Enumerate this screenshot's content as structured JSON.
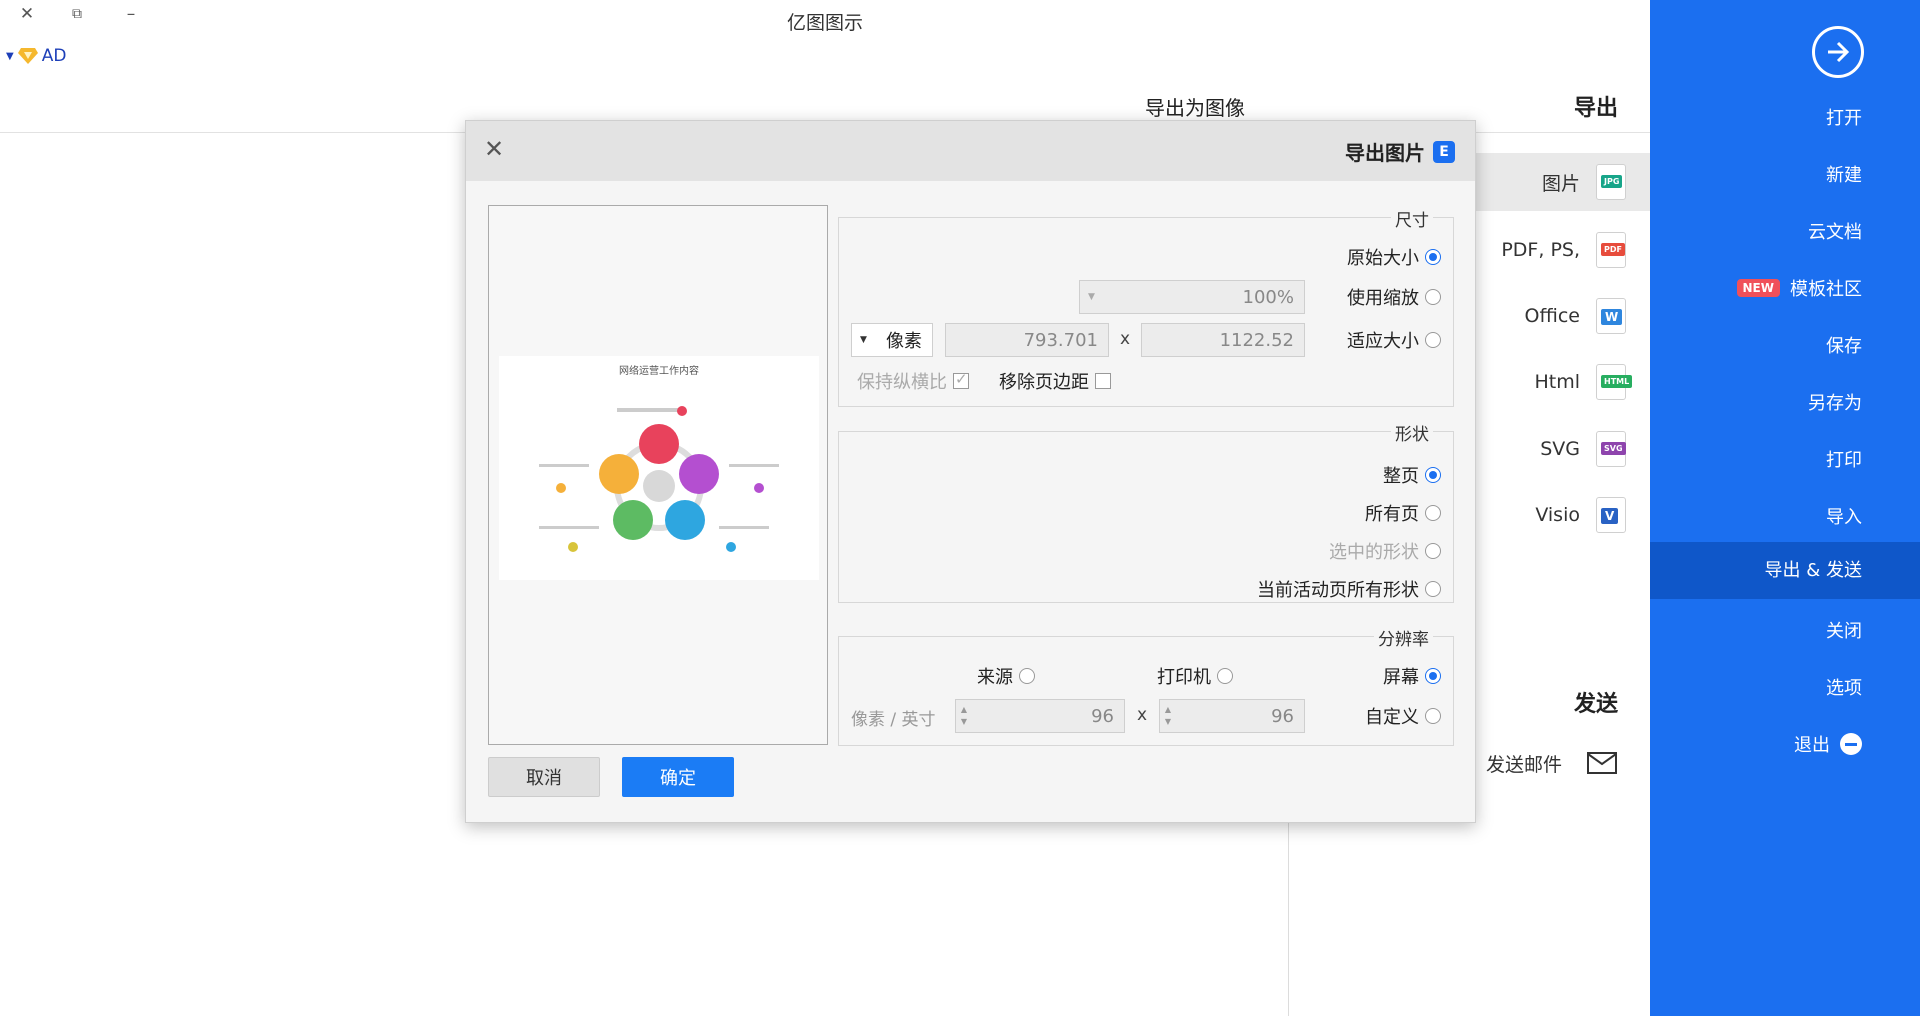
{
  "window": {
    "title": "亿图图示",
    "close": "✕",
    "restore": "⧉",
    "minimize": "–"
  },
  "user": {
    "label": "AD"
  },
  "sidebar": {
    "items": [
      {
        "label": "打开"
      },
      {
        "label": "新建"
      },
      {
        "label": "云文档"
      },
      {
        "label": "模板社区",
        "badge": "NEW"
      },
      {
        "label": "保存"
      },
      {
        "label": "另存为"
      },
      {
        "label": "打印"
      },
      {
        "label": "导入"
      },
      {
        "label": "导出 & 发送"
      },
      {
        "label": "关闭"
      },
      {
        "label": "选项"
      },
      {
        "label": "退出"
      }
    ]
  },
  "export_panel": {
    "heading": "导出",
    "subtitle": "导出为图像",
    "send_heading": "发送",
    "rows": [
      {
        "label": "图片",
        "tag": "JPG",
        "color": "#17a589"
      },
      {
        "label": "PDF, PS,",
        "tag": "PDF",
        "color": "#e74c3c"
      },
      {
        "label": "Office",
        "tag": "W",
        "color": "#2e86de"
      },
      {
        "label": "Html",
        "tag": "HTML",
        "color": "#27ae60"
      },
      {
        "label": "SVG",
        "tag": "SVG",
        "color": "#8e44ad"
      },
      {
        "label": "Visio",
        "tag": "V",
        "color": "#2962c4"
      }
    ],
    "send_mail": "发送邮件"
  },
  "dialog": {
    "title": "导出图片",
    "logo": "E",
    "size_group": {
      "title": "尺寸",
      "original": "原始大小",
      "scale": "使用缩放",
      "scale_value": "100%",
      "fit": "适应大小",
      "width": "1122.52",
      "height": "793.701",
      "x": "x",
      "unit": "像素",
      "remove_margin": "移除页边距",
      "keep_ratio": "保持纵横比"
    },
    "shape_group": {
      "title": "形状",
      "whole_page": "整页",
      "all_pages": "所有页",
      "selected": "选中的形状",
      "current_all": "当前活动页所有形状"
    },
    "resolution_group": {
      "title": "分辨率",
      "screen": "屏幕",
      "printer": "打印机",
      "source": "来源",
      "custom": "自定义",
      "dpi_x": "96",
      "dpi_y": "96",
      "x": "x",
      "unit": "像素 / 英寸"
    },
    "ok": "确定",
    "cancel": "取消",
    "preview_title": "网络运营工作内容"
  },
  "colors": {
    "brand_blue": "#1b6ff0",
    "active_blue": "#0f57c9"
  }
}
